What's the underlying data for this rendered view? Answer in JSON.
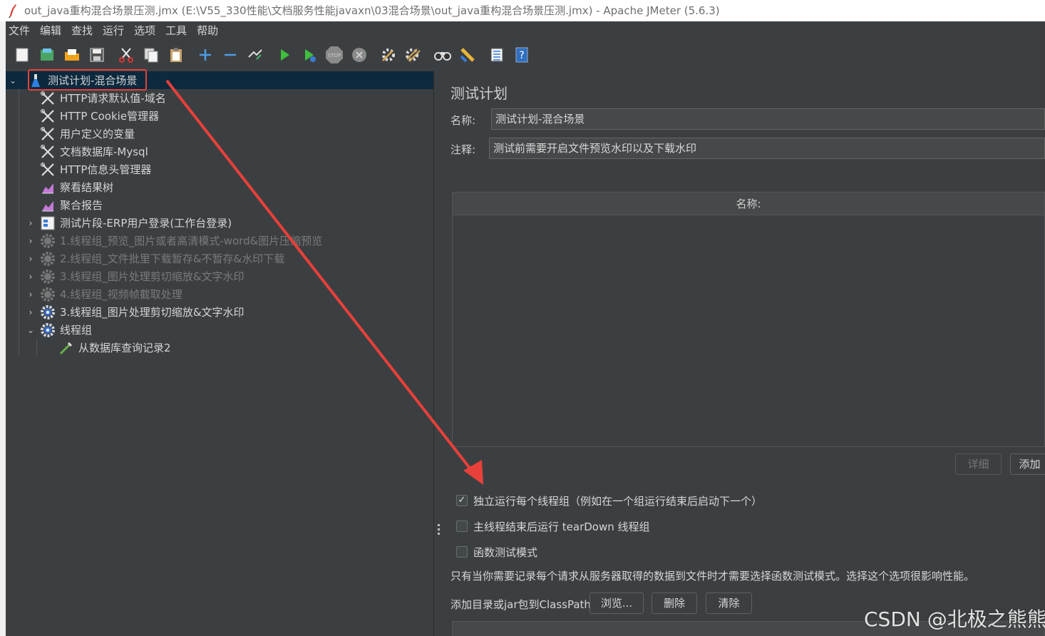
{
  "window": {
    "title": "out_java重构混合场景压测.jmx (E:\\V55_330性能\\文档服务性能javaxn\\03混合场景\\out_java重构混合场景压测.jmx) - Apache JMeter (5.6.3)"
  },
  "menu": [
    "文件",
    "编辑",
    "查找",
    "运行",
    "选项",
    "工具",
    "帮助"
  ],
  "toolbar": {
    "icons": [
      "new-icon",
      "templates-icon",
      "open-icon",
      "save-icon",
      "cut-icon",
      "copy-icon",
      "paste-icon",
      "expand-icon",
      "collapse-icon",
      "toggle-icon",
      "start-icon",
      "start-no-pause-icon",
      "stop-icon",
      "shutdown-icon",
      "clear-icon",
      "clear-all-icon",
      "search-icon",
      "reset-search-icon",
      "function-helper-icon",
      "help-icon"
    ]
  },
  "tree": {
    "root": {
      "label": "测试计划-混合场景"
    },
    "items": [
      {
        "label": "HTTP请求默认值-域名",
        "icon": "wrench-icon",
        "disabled": false
      },
      {
        "label": "HTTP Cookie管理器",
        "icon": "wrench-icon",
        "disabled": false
      },
      {
        "label": "用户定义的变量",
        "icon": "wrench-icon",
        "disabled": false
      },
      {
        "label": "文档数据库-Mysql",
        "icon": "wrench-icon",
        "disabled": false
      },
      {
        "label": "HTTP信息头管理器",
        "icon": "wrench-icon",
        "disabled": false
      },
      {
        "label": "察看结果树",
        "icon": "chart-icon",
        "disabled": false
      },
      {
        "label": "聚合报告",
        "icon": "chart-icon",
        "disabled": false
      },
      {
        "label": "测试片段-ERP用户登录(工作台登录)",
        "icon": "fragment-icon",
        "disabled": false
      },
      {
        "label": "1.线程组_预览_图片或者高清模式-word&图片压缩预览",
        "icon": "gear-icon",
        "disabled": true
      },
      {
        "label": "2.线程组_文件批里下载暂存&不暂存&水印下载",
        "icon": "gear-icon",
        "disabled": true
      },
      {
        "label": "3.线程组_图片处理剪切缩放&文字水印",
        "icon": "gear-icon",
        "disabled": true
      },
      {
        "label": "4.线程组_视频帧截取处理",
        "icon": "gear-icon",
        "disabled": true
      },
      {
        "label": "3.线程组_图片处理剪切缩放&文字水印",
        "icon": "gear-icon",
        "disabled": false
      },
      {
        "label": "线程组",
        "icon": "gear-icon",
        "disabled": false
      },
      {
        "label": "从数据库查询记录2",
        "icon": "pipette-icon",
        "disabled": false
      }
    ]
  },
  "plan": {
    "panel_title": "测试计划",
    "name_label": "名称:",
    "name_value": "测试计划-混合场景",
    "comment_label": "注释:",
    "comment_value": "测试前需要开启文件预览水印以及下载水印",
    "table_header": "名称:",
    "detail_button": "详细",
    "add_button": "添加",
    "options": [
      {
        "label": "独立运行每个线程组（例如在一个组运行结束后启动下一个）",
        "checked": true
      },
      {
        "label": "主线程结束后运行 tearDown 线程组",
        "checked": false
      },
      {
        "label": "函数测试模式",
        "checked": false
      }
    ],
    "help_text": "只有当你需要记录每个请求从服务器取得的数据到文件时才需要选择函数测试模式。选择这个选项很影响性能。",
    "classpath_label": "添加目录或jar包到ClassPath",
    "browse_button": "浏览...",
    "delete_button": "删除",
    "clear_button": "清除"
  },
  "watermark": "CSDN @北极之熊熊",
  "colors": {
    "background": "#3c3f41",
    "selection": "#0d293e",
    "annotation": "#e8403a"
  }
}
